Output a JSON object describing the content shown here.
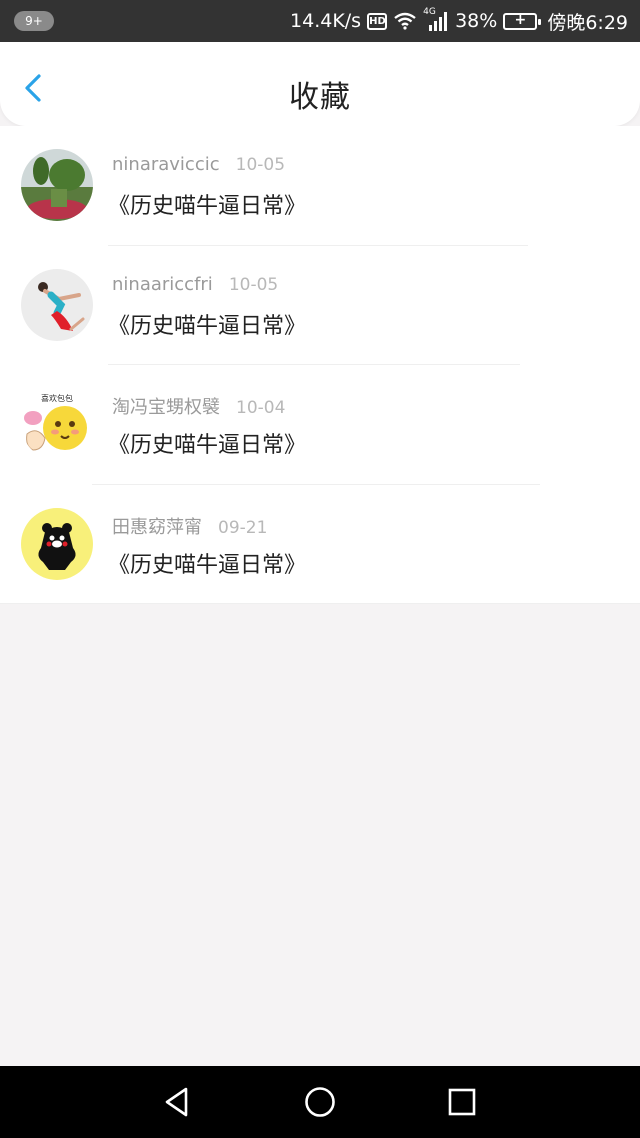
{
  "status_bar": {
    "badge": "9+",
    "network_speed": "14.4K/s",
    "hd": "HD",
    "network_type": "4G",
    "battery": "38%",
    "time": "傍晚6:29"
  },
  "header": {
    "title": "收藏",
    "accent_color": "#2aa3e8"
  },
  "items": [
    {
      "user": "ninaraviccic",
      "time": "10-05",
      "title": "《历史喵牛逼日常》"
    },
    {
      "user": "ninaariccfri",
      "time": "10-05",
      "title": "《历史喵牛逼日常》"
    },
    {
      "user": "淘冯宝甥权襞",
      "time": "10-04",
      "title": "《历史喵牛逼日常》"
    },
    {
      "user": "田惠窈萍甯",
      "time": "09-21",
      "title": "《历史喵牛逼日常》"
    }
  ],
  "avatars": {
    "item3_caption": "喜欢包包"
  },
  "nav_icons": [
    "back-triangle-icon",
    "home-circle-icon",
    "recents-square-icon"
  ]
}
